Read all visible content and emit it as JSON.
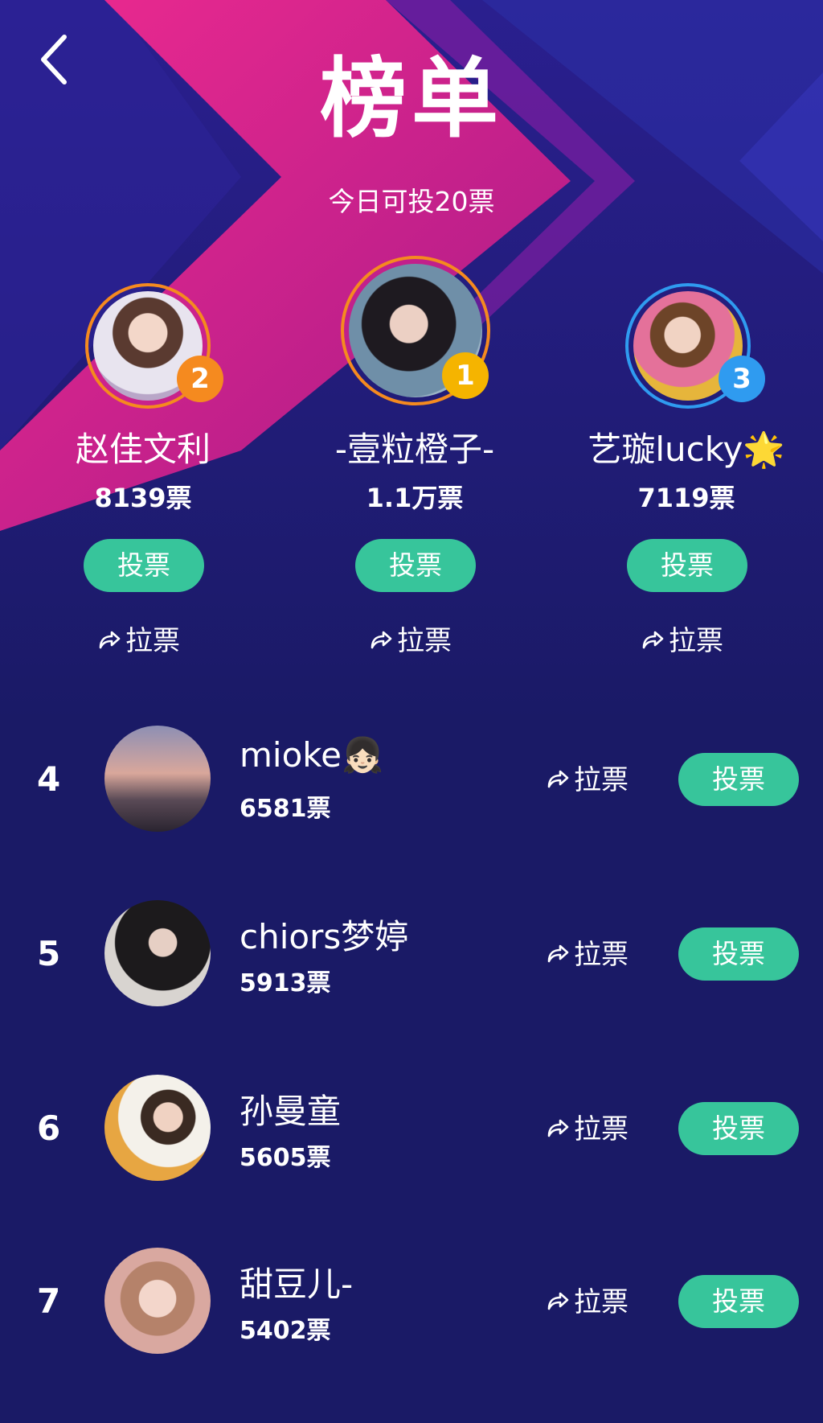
{
  "header": {
    "title": "榜单",
    "subtitle": "今日可投20票"
  },
  "podium": [
    {
      "rank": "2",
      "name": "赵佳文利",
      "votes": "8139票"
    },
    {
      "rank": "1",
      "name": "-壹粒橙子-",
      "votes": "1.1万票"
    },
    {
      "rank": "3",
      "name": "艺璇lucky",
      "votes": "7119票",
      "emoji": "🌟"
    }
  ],
  "list": [
    {
      "rank": "4",
      "name": "mioke",
      "emoji": "👧🏻",
      "votes": "6581票"
    },
    {
      "rank": "5",
      "name": "chiors梦婷",
      "votes": "5913票"
    },
    {
      "rank": "6",
      "name": "孙曼童",
      "votes": "5605票"
    },
    {
      "rank": "7",
      "name": "甜豆儿-",
      "votes": "5402票"
    }
  ],
  "actions": {
    "vote_label": "投票",
    "share_label": "拉票"
  },
  "colors": {
    "background": "#1a1a66",
    "magenta": "#e0248f",
    "vote_button": "#37c59b",
    "gold_badge": "#f5b400",
    "orange_badge": "#f58a1f",
    "blue_badge": "#2f9bf0"
  },
  "icons": [
    "back-arrow-icon",
    "share-arrow-icon"
  ]
}
